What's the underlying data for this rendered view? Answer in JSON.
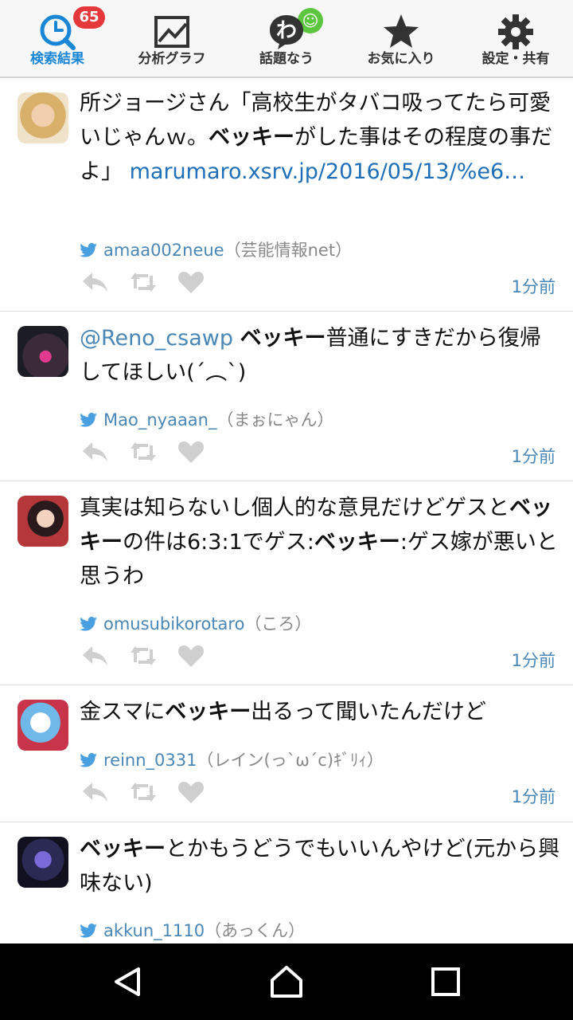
{
  "tabs": [
    {
      "label": "検索結果",
      "icon": "clock-search-icon",
      "active": true,
      "badge": "65"
    },
    {
      "label": "分析グラフ",
      "icon": "chart-icon",
      "badge": "☺"
    },
    {
      "label": "話題なう",
      "icon": "wa-icon"
    },
    {
      "label": "お気に入り",
      "icon": "star-icon"
    },
    {
      "label": "設定・共有",
      "icon": "gear-icon"
    }
  ],
  "tweets": [
    {
      "parts": [
        "所ジョージさん「高校生がタバコ吸ってたら可愛いじゃんｗ。",
        "ベッキー",
        "がした事はその程度の事だよ」 ",
        "marumaro.xsrv.jp/2016/05/13/%e6…"
      ],
      "user": "amaa002neue",
      "name": "（芸能情報net）",
      "time": "1分前"
    },
    {
      "parts": [
        "@Reno_csawp",
        " ",
        "ベッキー",
        "普通にすきだから復帰してほしい(´︵`)"
      ],
      "user": "Mao_nyaaan_",
      "name": "（まぉにゃん）",
      "time": "1分前"
    },
    {
      "parts": [
        "真実は知らないし個人的な意見だけどゲスと",
        "ベッキー",
        "の件は6:3:1でゲス:",
        "ベッキー",
        ":ゲス嫁が悪いと思うわ"
      ],
      "user": "omusubikorotaro",
      "name": "（ころ）",
      "time": "1分前"
    },
    {
      "parts": [
        "金スマに",
        "ベッキー",
        "出るって聞いたんだけど"
      ],
      "user": "reinn_0331",
      "name": "（レイン(っ`ω´c)ｷﾞﾘｨ）",
      "time": "1分前"
    },
    {
      "parts": [
        "ベッキー",
        "とかもうどうでもいいんやけど(元から興味ない)"
      ],
      "user": "akkun_1110",
      "name": "（あっくん）",
      "time": ""
    }
  ],
  "colors": {
    "accent": "#1a86d6",
    "link": "#4a86b6",
    "badge_red": "#e5383b",
    "badge_green": "#5cc63f"
  }
}
